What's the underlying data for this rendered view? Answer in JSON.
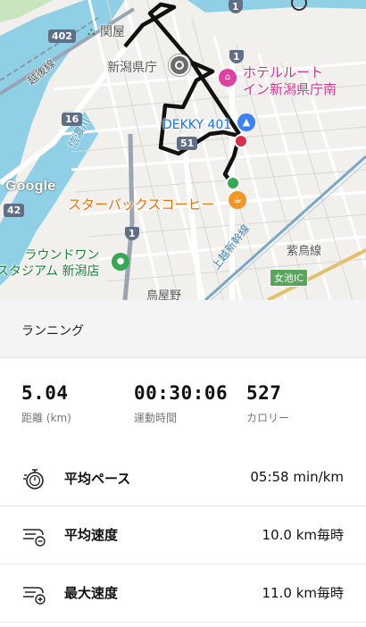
{
  "map": {
    "labels": {
      "sekiya": "関屋",
      "prefecture_office": "新潟県庁",
      "hotel": "ホテルルート\nイン新潟県庁南",
      "dekky": "DEKKY 401",
      "starbucks": "スターバックスコーヒー",
      "round1": "ラウンドワン\nスタジアム 新潟店",
      "echigo_line": "越後線",
      "shinano_river": "信濃川",
      "joetsu_shinkansen": "上越新幹線",
      "hakusan_line": "紫鳥線",
      "toriyano": "鳥屋野",
      "ic": "女池IC",
      "google": "Google"
    },
    "shields": [
      "402",
      "16",
      "42",
      "51",
      "1",
      "1",
      "1"
    ],
    "icons": [
      "station-icon",
      "landmark-icon",
      "hotel-icon",
      "shopping-icon",
      "cafe-icon",
      "stadium-icon",
      "start-marker-icon",
      "end-marker-icon"
    ],
    "colors": {
      "route": "#111111",
      "water": "#8fd0e6",
      "park": "#c9e5c0",
      "hotel_pin": "#e040a0",
      "shop_pin": "#3b82f6",
      "cafe_pin": "#f29724",
      "green_pin": "#34a853",
      "end_marker": "#dc2f4a"
    }
  },
  "activity": {
    "type": "ランニング"
  },
  "stats": {
    "distance": {
      "value": "5.04",
      "label": "距離 (km)"
    },
    "duration": {
      "value": "00:30:06",
      "label": "運動時間"
    },
    "calories": {
      "value": "527",
      "label": "カロリー"
    }
  },
  "details": [
    {
      "name": "平均ペース",
      "value": "05:58 min/km",
      "icon": "stopwatch-icon"
    },
    {
      "name": "平均速度",
      "value": "10.0 km毎時",
      "icon": "speed-average-icon"
    },
    {
      "name": "最大速度",
      "value": "11.0 km毎時",
      "icon": "speed-max-icon"
    }
  ]
}
